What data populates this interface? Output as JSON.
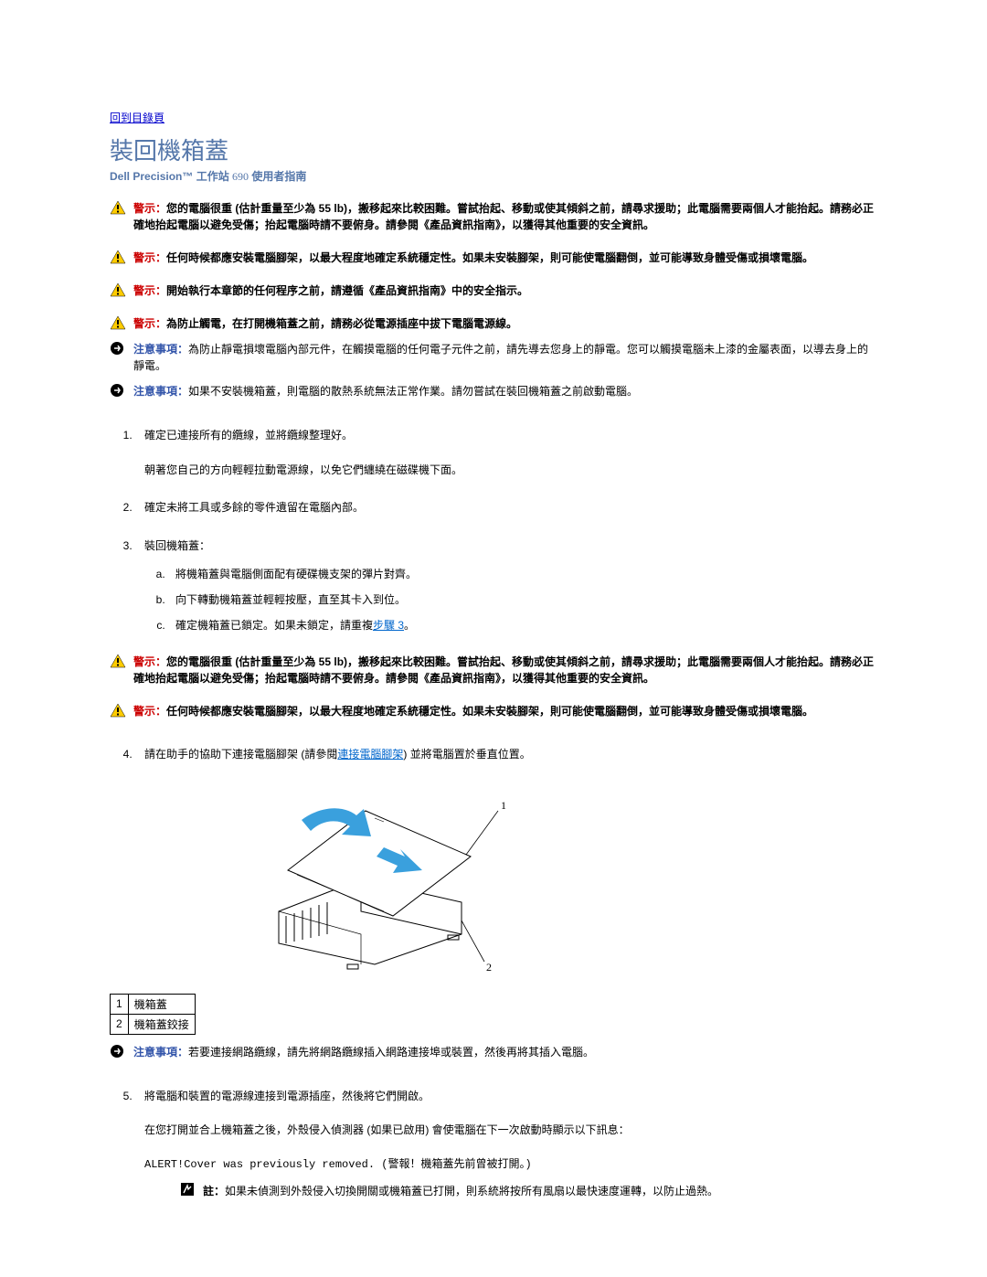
{
  "toc_link": "回到目錄頁",
  "title": "裝回機箱蓋",
  "subtitle_prefix": "Dell Precision™ 工作站 ",
  "subtitle_model": "690",
  "subtitle_suffix": " 使用者指南",
  "warn_label": "警示：",
  "notice_label": "注意事項：",
  "note_label": "註：",
  "warnings_top": [
    "您的電腦很重 (估計重量至少為 55 lb)，搬移起來比較困難。嘗試抬起、移動或使其傾斜之前，請尋求援助；此電腦需要兩個人才能抬起。請務必正確地抬起電腦以避免受傷；抬起電腦時請不要俯身。請參閱《產品資訊指南》，以獲得其他重要的安全資訊。",
    "任何時候都應安裝電腦腳架，以最大程度地確定系統穩定性。如果未安裝腳架，則可能使電腦翻倒，並可能導致身體受傷或損壞電腦。",
    "開始執行本章節的任何程序之前，請遵循《產品資訊指南》中的安全指示。",
    "為防止觸電，在打開機箱蓋之前，請務必從電源插座中拔下電腦電源線。"
  ],
  "notices_top": [
    "為防止靜電損壞電腦內部元件，在觸摸電腦的任何電子元件之前，請先導去您身上的靜電。您可以觸摸電腦未上漆的金屬表面，以導去身上的靜電。",
    "如果不安裝機箱蓋，則電腦的散熱系統無法正常作業。請勿嘗試在裝回機箱蓋之前啟動電腦。"
  ],
  "steps": {
    "s1": "確定已連接所有的纜線，並將纜線整理好。",
    "s1_para": "朝著您自己的方向輕輕拉動電源線，以免它們纏繞在磁碟機下面。",
    "s2": "確定未將工具或多餘的零件遺留在電腦內部。",
    "s3": "裝回機箱蓋：",
    "s3a": "將機箱蓋與電腦側面配有硬碟機支架的彈片對齊。",
    "s3b": "向下轉動機箱蓋並輕輕按壓，直至其卡入到位。",
    "s3c_before": "確定機箱蓋已鎖定。如果未鎖定，請重複",
    "s3c_link": "步驟 3",
    "s3c_after": "。",
    "s4_before": "請在助手的協助下連接電腦腳架 (請參閱",
    "s4_link": "連接電腦腳架",
    "s4_after": ") 並將電腦置於垂直位置。",
    "s5": "將電腦和裝置的電源線連接到電源插座，然後將它們開啟。",
    "s5_p1": "在您打開並合上機箱蓋之後，外殼侵入偵測器 (如果已啟用) 會使電腦在下一次啟動時顯示以下訊息：",
    "s5_code": "ALERT!Cover was previously removed. (警報！機箱蓋先前曾被打開。)"
  },
  "warnings_mid": [
    "您的電腦很重 (估計重量至少為 55 lb)，搬移起來比較困難。嘗試抬起、移動或使其傾斜之前，請尋求援助；此電腦需要兩個人才能抬起。請務必正確地抬起電腦以避免受傷；抬起電腦時請不要俯身。請參閱《產品資訊指南》，以獲得其他重要的安全資訊。",
    "任何時候都應安裝電腦腳架，以最大程度地確定系統穩定性。如果未安裝腳架，則可能使電腦翻倒，並可能導致身體受傷或損壞電腦。"
  ],
  "legend": {
    "r1n": "1",
    "r1t": "機箱蓋",
    "r2n": "2",
    "r2t": "機箱蓋鉸接"
  },
  "notice_bottom": "若要連接網路纜線，請先將網路纜線插入網路連接埠或裝置，然後再將其插入電腦。",
  "note_bottom": "如果未偵測到外殼侵入切換開關或機箱蓋已打開，則系統將按所有風扇以最快速度運轉，以防止過熱。"
}
